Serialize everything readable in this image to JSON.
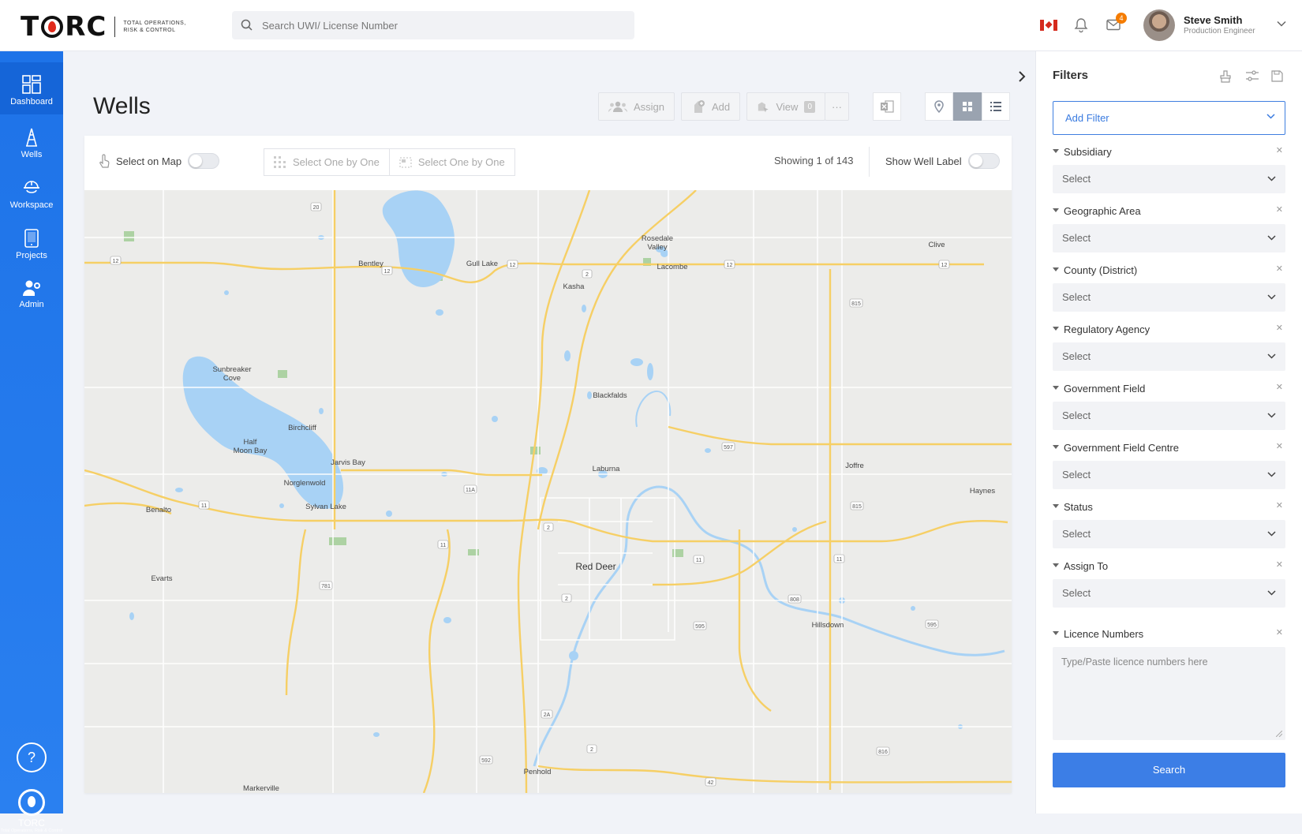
{
  "header": {
    "logo_text": "TORC",
    "logo_tagline": "TOTAL OPERATIONS, RISK & CONTROL",
    "search_placeholder": "Search UWI/ License Number",
    "notification_count": "4",
    "user_name": "Steve Smith",
    "user_role": "Production Engineer"
  },
  "sidebar": {
    "items": [
      {
        "label": "Dashboard",
        "icon": "dashboard-icon"
      },
      {
        "label": "Wells",
        "icon": "well-rig-icon"
      },
      {
        "label": "Workspace",
        "icon": "worker-helmet-icon"
      },
      {
        "label": "Projects",
        "icon": "tablet-icon"
      },
      {
        "label": "Admin",
        "icon": "admin-user-gear-icon"
      }
    ],
    "help_label": "?",
    "footer_logo": "TORC",
    "footer_tagline": "Total Operations, Risk & Control"
  },
  "main": {
    "title": "Wells",
    "assign_label": "Assign",
    "add_label": "Add",
    "view_label": "View",
    "view_count": "0",
    "more_label": "···",
    "toolbar": {
      "select_on_map": "Select on Map",
      "select_one_a": "Select One by One",
      "select_one_b": "Select One by One",
      "showing": "Showing 1 of 143",
      "show_well_label": "Show Well Label"
    }
  },
  "map": {
    "places": [
      {
        "name": "Bentley"
      },
      {
        "name": "Gull Lake"
      },
      {
        "name": "Rosedale Valley"
      },
      {
        "name": "Lacombe"
      },
      {
        "name": "Kasha"
      },
      {
        "name": "Clive"
      },
      {
        "name": "Sunbreaker Cove"
      },
      {
        "name": "Birchcliff"
      },
      {
        "name": "Half Moon Bay"
      },
      {
        "name": "Jarvis Bay"
      },
      {
        "name": "Norglenwold"
      },
      {
        "name": "Sylvan Lake"
      },
      {
        "name": "Blackfalds"
      },
      {
        "name": "Laburna"
      },
      {
        "name": "Joffre"
      },
      {
        "name": "Haynes"
      },
      {
        "name": "Benalto"
      },
      {
        "name": "Red Deer"
      },
      {
        "name": "Evarts"
      },
      {
        "name": "Hillsdown"
      },
      {
        "name": "Penhold"
      },
      {
        "name": "Markerville"
      }
    ],
    "shields": [
      "20",
      "12",
      "12",
      "12",
      "2",
      "12",
      "12",
      "815",
      "597",
      "11A",
      "11",
      "2",
      "11",
      "11",
      "815",
      "11",
      "781",
      "2",
      "808",
      "595",
      "595",
      "2A",
      "2",
      "592",
      "816",
      "42"
    ]
  },
  "filters": {
    "title": "Filters",
    "add_filter": "Add Filter",
    "groups": [
      {
        "label": "Subsidiary",
        "value": "Select"
      },
      {
        "label": "Geographic Area",
        "value": "Select"
      },
      {
        "label": "County (District)",
        "value": "Select"
      },
      {
        "label": "Regulatory Agency",
        "value": "Select"
      },
      {
        "label": "Government Field",
        "value": "Select"
      },
      {
        "label": "Government Field Centre",
        "value": "Select"
      },
      {
        "label": "Status",
        "value": "Select"
      },
      {
        "label": "Assign To",
        "value": "Select"
      }
    ],
    "licence_label": "Licence Numbers",
    "licence_placeholder": "Type/Paste licence numbers here",
    "search_label": "Search"
  },
  "colors": {
    "accent": "#3c7ee6",
    "sidebar": "#1e73e8",
    "road": "#f6cf65",
    "water": "#a9d3f7",
    "badge": "#f57c00"
  }
}
